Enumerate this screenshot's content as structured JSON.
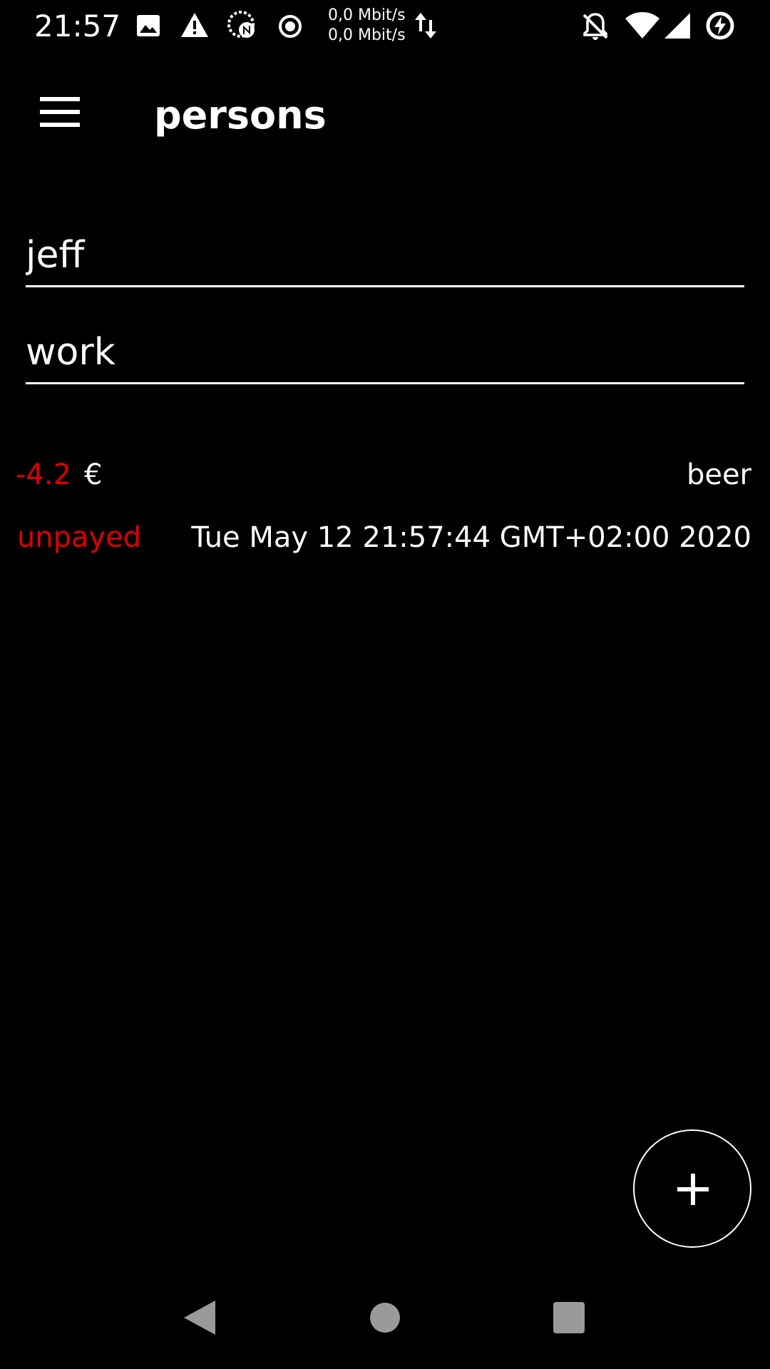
{
  "status_bar": {
    "time": "21:57",
    "net_up": "0,0 Mbit/s",
    "net_down": "0,0 Mbit/s",
    "left_icons": [
      "image-icon",
      "warning-icon",
      "data-saver-icon",
      "record-icon",
      "data-transfer-icon"
    ],
    "right_icons": [
      "notifications-off-icon",
      "wifi-icon",
      "signal-icon",
      "battery-charging-icon"
    ]
  },
  "app_bar": {
    "title": "persons",
    "menu_icon": "hamburger-menu-icon"
  },
  "form": {
    "name_value": "jeff",
    "group_value": "work"
  },
  "entries": [
    {
      "amount": "-4.2",
      "currency": "€",
      "description": "beer",
      "status": "unpayed",
      "date": "Tue May 12 21:57:44 GMT+02:00 2020"
    }
  ],
  "fab": {
    "icon": "plus-icon"
  },
  "nav_bar": {
    "buttons": [
      "back-icon",
      "home-icon",
      "recents-icon"
    ]
  },
  "colors": {
    "background": "#000000",
    "text": "#ffffff",
    "negative": "#e00000"
  }
}
